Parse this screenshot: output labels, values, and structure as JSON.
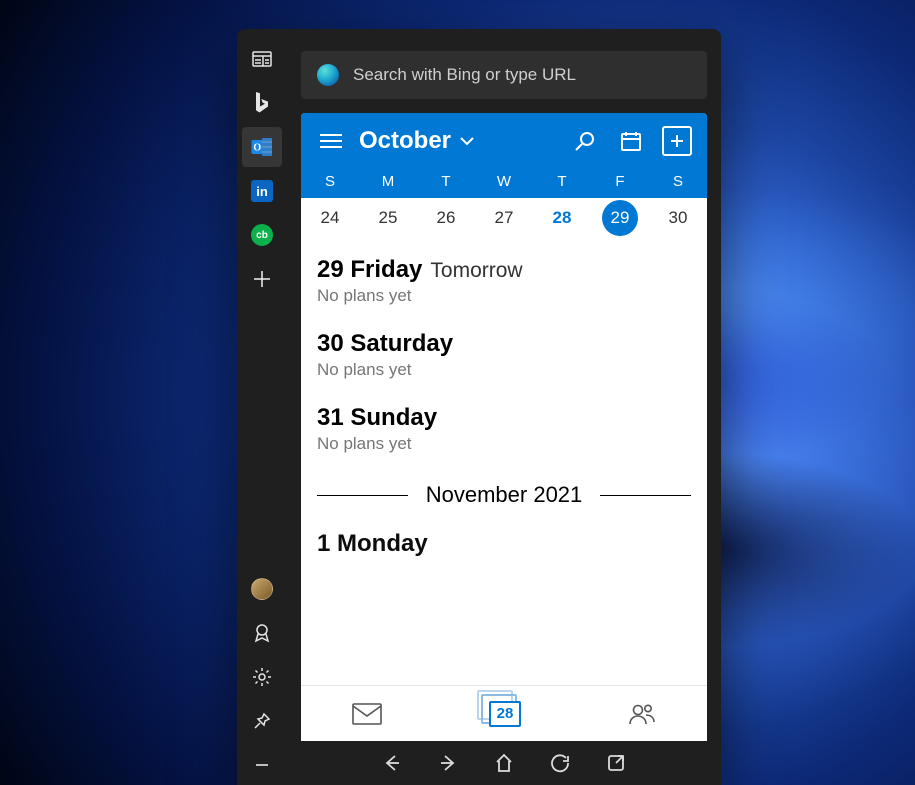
{
  "search": {
    "placeholder": "Search with Bing or type URL"
  },
  "calendar": {
    "month_label": "October",
    "dow": [
      "S",
      "M",
      "T",
      "W",
      "T",
      "F",
      "S"
    ],
    "dates": [
      "24",
      "25",
      "26",
      "27",
      "28",
      "29",
      "30"
    ],
    "today_index": 4,
    "selected_index": 5,
    "footer_day": "28"
  },
  "agenda": [
    {
      "day": "29 Friday",
      "sub": "Tomorrow",
      "note": "No plans yet"
    },
    {
      "day": "30 Saturday",
      "sub": "",
      "note": "No plans yet"
    },
    {
      "day": "31 Sunday",
      "sub": "",
      "note": "No plans yet"
    }
  ],
  "divider": {
    "label": "November 2021"
  },
  "agenda_tail": [
    {
      "day": "1 Monday",
      "sub": "",
      "note": ""
    }
  ],
  "sidebar": {
    "linkedin": "in",
    "cb": "cb"
  }
}
